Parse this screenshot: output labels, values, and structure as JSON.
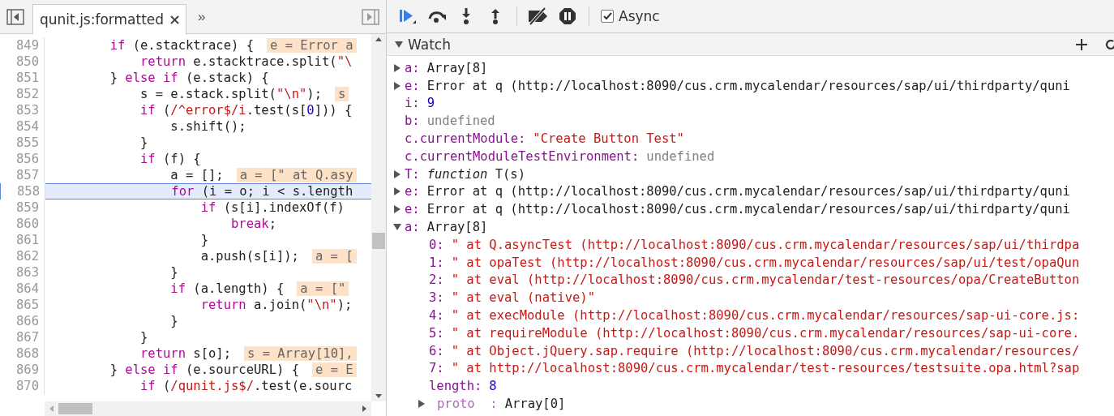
{
  "editor": {
    "tabs": [
      {
        "label": "qunit.js:formatted",
        "selected": true
      }
    ],
    "more": "»",
    "lines": [
      {
        "number": "849",
        "current": false,
        "tokens": [
          {
            "kind": "kw",
            "text": "        if"
          },
          {
            "kind": "plain",
            "text": " (e.stacktrace) {"
          },
          {
            "kind": "val",
            "text": "e = Error a"
          }
        ]
      },
      {
        "number": "850",
        "current": false,
        "tokens": [
          {
            "kind": "kw",
            "text": "            return"
          },
          {
            "kind": "plain",
            "text": " e.stacktrace.split("
          },
          {
            "kind": "str",
            "text": "\"\\"
          }
        ]
      },
      {
        "number": "851",
        "current": false,
        "tokens": [
          {
            "kind": "plain",
            "text": "        } "
          },
          {
            "kind": "kw",
            "text": "else if"
          },
          {
            "kind": "plain",
            "text": " (e.stack) {"
          }
        ]
      },
      {
        "number": "852",
        "current": false,
        "tokens": [
          {
            "kind": "plain",
            "text": "            s = e.stack.split("
          },
          {
            "kind": "str",
            "text": "\"\\n\""
          },
          {
            "kind": "plain",
            "text": ");"
          },
          {
            "kind": "val",
            "text": "s"
          }
        ]
      },
      {
        "number": "853",
        "current": false,
        "tokens": [
          {
            "kind": "kw",
            "text": "            if"
          },
          {
            "kind": "plain",
            "text": " ("
          },
          {
            "kind": "str",
            "text": "/^error$/i"
          },
          {
            "kind": "plain",
            "text": ".test(s["
          },
          {
            "kind": "num",
            "text": "0"
          },
          {
            "kind": "plain",
            "text": "])) {"
          }
        ]
      },
      {
        "number": "854",
        "current": false,
        "tokens": [
          {
            "kind": "plain",
            "text": "                s.shift();"
          }
        ]
      },
      {
        "number": "855",
        "current": false,
        "tokens": [
          {
            "kind": "plain",
            "text": "            }"
          }
        ]
      },
      {
        "number": "856",
        "current": false,
        "tokens": [
          {
            "kind": "kw",
            "text": "            if"
          },
          {
            "kind": "plain",
            "text": " (f) {"
          }
        ]
      },
      {
        "number": "857",
        "current": false,
        "tokens": [
          {
            "kind": "plain",
            "text": "                a = [];"
          },
          {
            "kind": "val",
            "text": "a = [\" at Q.asy"
          }
        ]
      },
      {
        "number": "858",
        "current": true,
        "tokens": [
          {
            "kind": "kw",
            "text": "                for"
          },
          {
            "kind": "plain",
            "text": " (i = o; i < s.length"
          }
        ]
      },
      {
        "number": "859",
        "current": false,
        "tokens": [
          {
            "kind": "kw",
            "text": "                    if"
          },
          {
            "kind": "plain",
            "text": " (s[i].indexOf(f)"
          }
        ]
      },
      {
        "number": "860",
        "current": false,
        "tokens": [
          {
            "kind": "kw",
            "text": "                        break"
          },
          {
            "kind": "plain",
            "text": ";"
          }
        ]
      },
      {
        "number": "861",
        "current": false,
        "tokens": [
          {
            "kind": "plain",
            "text": "                    }"
          }
        ]
      },
      {
        "number": "862",
        "current": false,
        "tokens": [
          {
            "kind": "plain",
            "text": "                    a.push(s[i]);"
          },
          {
            "kind": "val",
            "text": "a = ["
          }
        ]
      },
      {
        "number": "863",
        "current": false,
        "tokens": [
          {
            "kind": "plain",
            "text": "                }"
          }
        ]
      },
      {
        "number": "864",
        "current": false,
        "tokens": [
          {
            "kind": "kw",
            "text": "                if"
          },
          {
            "kind": "plain",
            "text": " (a.length) {"
          },
          {
            "kind": "val",
            "text": "a = [\""
          }
        ]
      },
      {
        "number": "865",
        "current": false,
        "tokens": [
          {
            "kind": "kw",
            "text": "                    return"
          },
          {
            "kind": "plain",
            "text": " a.join("
          },
          {
            "kind": "str",
            "text": "\"\\n\""
          },
          {
            "kind": "plain",
            "text": ");"
          }
        ]
      },
      {
        "number": "866",
        "current": false,
        "tokens": [
          {
            "kind": "plain",
            "text": "                }"
          }
        ]
      },
      {
        "number": "867",
        "current": false,
        "tokens": [
          {
            "kind": "plain",
            "text": "            }"
          }
        ]
      },
      {
        "number": "868",
        "current": false,
        "tokens": [
          {
            "kind": "kw",
            "text": "            return"
          },
          {
            "kind": "plain",
            "text": " s[o];"
          },
          {
            "kind": "val",
            "text": "s = Array[10],"
          }
        ]
      },
      {
        "number": "869",
        "current": false,
        "tokens": [
          {
            "kind": "plain",
            "text": "        } "
          },
          {
            "kind": "kw",
            "text": "else if"
          },
          {
            "kind": "plain",
            "text": " (e.sourceURL) {"
          },
          {
            "kind": "val",
            "text": "e = E"
          }
        ]
      },
      {
        "number": "870",
        "current": false,
        "tokens": [
          {
            "kind": "kw",
            "text": "            if"
          },
          {
            "kind": "plain",
            "text": " ("
          },
          {
            "kind": "str",
            "text": "/qunit.js$/"
          },
          {
            "kind": "plain",
            "text": ".test(e.sourc"
          }
        ]
      }
    ]
  },
  "debugger": {
    "async": {
      "label": "Async",
      "checked": true
    },
    "watch": {
      "title": "Watch",
      "expanded": true,
      "items": [
        {
          "name": "a:",
          "value": "Array[8]",
          "kind": "object",
          "expanded": false
        },
        {
          "name": "e:",
          "value": "Error at q (http://localhost:8090/cus.crm.mycalendar/resources/sap/ui/thirdparty/quni",
          "kind": "object",
          "expanded": false
        },
        {
          "name": "i:",
          "value": "9",
          "kind": "number"
        },
        {
          "name": "b:",
          "value": "undefined",
          "kind": "undefined"
        },
        {
          "name": "c.currentModule:",
          "value": "\"Create Button Test\"",
          "kind": "string"
        },
        {
          "name": "c.currentModuleTestEnvironment:",
          "value": "undefined",
          "kind": "undefined"
        },
        {
          "name": "T:",
          "value": "*function* T(s)",
          "kind": "function",
          "expanded": false
        },
        {
          "name": "e:",
          "value": "Error at q (http://localhost:8090/cus.crm.mycalendar/resources/sap/ui/thirdparty/quni",
          "kind": "object",
          "expanded": false
        },
        {
          "name": "e:",
          "value": "Error at q (http://localhost:8090/cus.crm.mycalendar/resources/sap/ui/thirdparty/quni",
          "kind": "object",
          "expanded": false
        },
        {
          "name": "a:",
          "value": "Array[8]",
          "kind": "object",
          "expanded": true,
          "children": [
            {
              "name": "0:",
              "value": "\" at Q.asyncTest (http://localhost:8090/cus.crm.mycalendar/resources/sap/ui/thirdpa",
              "kind": "string"
            },
            {
              "name": "1:",
              "value": "\" at opaTest (http://localhost:8090/cus.crm.mycalendar/resources/sap/ui/test/opaQun",
              "kind": "string"
            },
            {
              "name": "2:",
              "value": "\" at eval (http://localhost:8090/cus.crm.mycalendar/test-resources/opa/CreateButton",
              "kind": "string"
            },
            {
              "name": "3:",
              "value": "\" at eval (native)\"",
              "kind": "string"
            },
            {
              "name": "4:",
              "value": "\" at execModule (http://localhost:8090/cus.crm.mycalendar/resources/sap-ui-core.js:",
              "kind": "string"
            },
            {
              "name": "5:",
              "value": "\" at requireModule (http://localhost:8090/cus.crm.mycalendar/resources/sap-ui-core.",
              "kind": "string"
            },
            {
              "name": "6:",
              "value": "\" at Object.jQuery.sap.require (http://localhost:8090/cus.crm.mycalendar/resources/",
              "kind": "string"
            },
            {
              "name": "7:",
              "value": "\" at http://localhost:8090/cus.crm.mycalendar/test-resources/testsuite.opa.html?sap",
              "kind": "string"
            },
            {
              "name": "length:",
              "value": "8",
              "kind": "number"
            },
            {
              "name": "proto  :",
              "value": "Array[0]",
              "kind": "internal",
              "expanded": false
            }
          ]
        }
      ]
    }
  }
}
